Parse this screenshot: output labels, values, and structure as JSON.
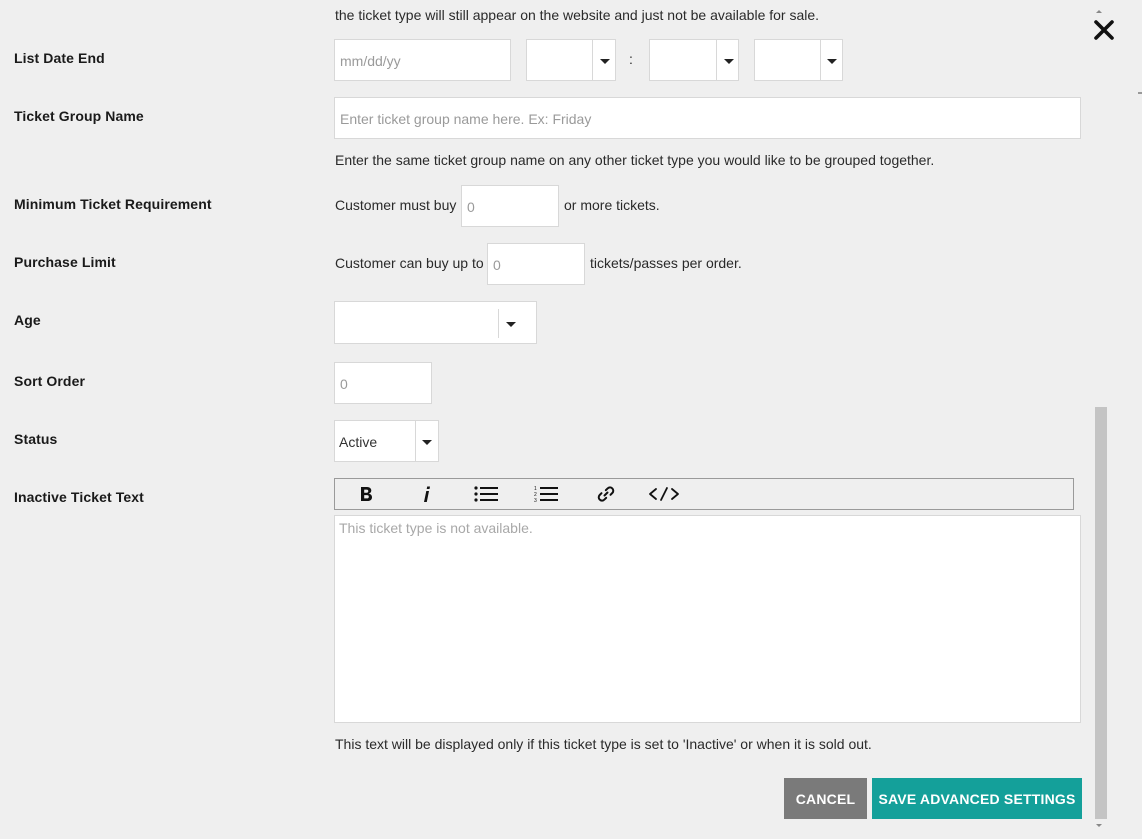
{
  "top_note": "the ticket type will still appear on the website and just not be available for sale.",
  "list_date_end": {
    "label": "List Date End",
    "date_placeholder": "mm/dd/yy",
    "time_separator": ":"
  },
  "ticket_group": {
    "label": "Ticket Group Name",
    "placeholder": "Enter ticket group name here. Ex: Friday",
    "help": "Enter the same ticket group name on any other ticket type you would like to be grouped together."
  },
  "min_ticket": {
    "label": "Minimum Ticket Requirement",
    "prefix": "Customer must buy",
    "value": "0",
    "suffix": "or more tickets."
  },
  "purchase_limit": {
    "label": "Purchase Limit",
    "prefix": "Customer can buy up to",
    "value": "0",
    "suffix": "tickets/passes per order."
  },
  "age": {
    "label": "Age",
    "value": ""
  },
  "sort_order": {
    "label": "Sort Order",
    "value": "0"
  },
  "status": {
    "label": "Status",
    "value": "Active"
  },
  "inactive_text": {
    "label": "Inactive Ticket Text",
    "placeholder": "This ticket type is not available.",
    "help": "This text will be displayed only if this ticket type is set to 'Inactive' or when it is sold out.",
    "toolbar": [
      "bold-icon",
      "italic-icon",
      "bullet-list-icon",
      "numbered-list-icon",
      "link-icon",
      "code-icon"
    ]
  },
  "buttons": {
    "cancel": "CANCEL",
    "save": "SAVE ADVANCED SETTINGS"
  },
  "colors": {
    "background": "#efefef",
    "cancel_bg": "#7a7a7a",
    "save_bg": "#14a09a"
  }
}
